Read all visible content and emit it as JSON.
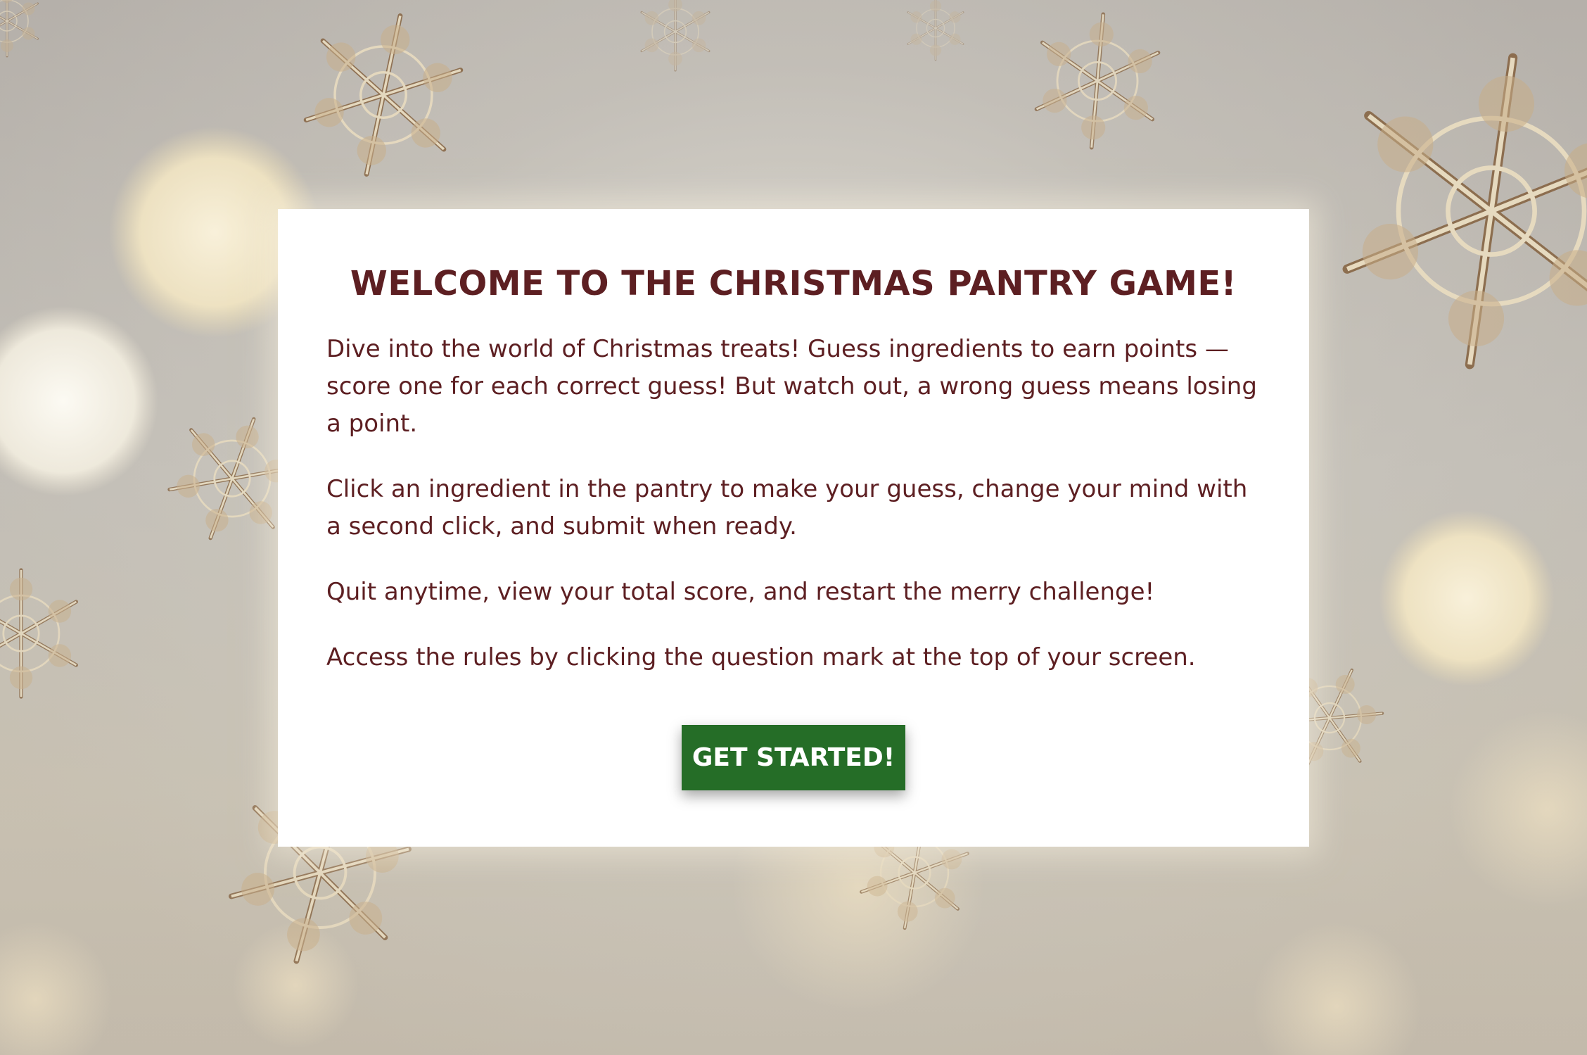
{
  "modal": {
    "title": "WELCOME TO THE CHRISTMAS PANTRY GAME!",
    "paragraphs": [
      "Dive into the world of Christmas treats! Guess ingredients to earn points — score one for each correct guess! But watch out, a wrong guess means losing a point.",
      "Click an ingredient in the pantry to make your guess, change your mind with a second click, and submit when ready.",
      "Quit anytime, view your total score, and restart the merry challenge!",
      "Access the rules by clicking the question mark at the top of your screen."
    ],
    "start_button_label": "GET STARTED!"
  },
  "colors": {
    "text": "#5d1f22",
    "button": "#256d27",
    "modal_background": "#ffffff"
  }
}
